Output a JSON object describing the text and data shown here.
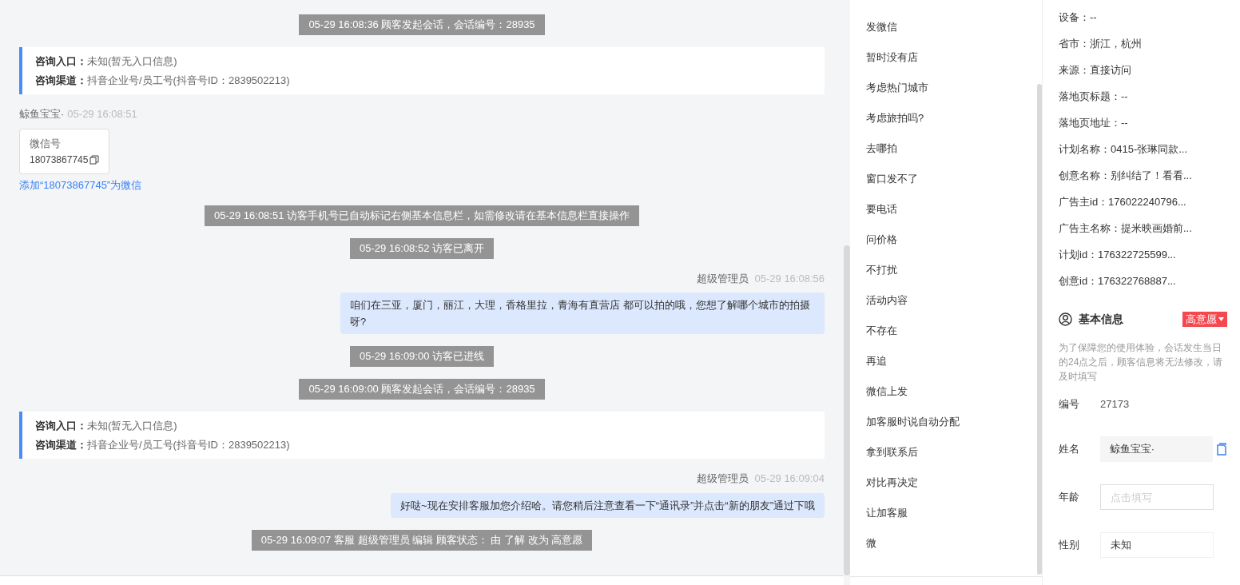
{
  "chat": [
    {
      "kind": "system",
      "text": "05-29 16:08:36 顾客发起会话，会话编号：28935"
    },
    {
      "kind": "info",
      "entry_label": "咨询入口：",
      "entry_value": "未知(暂无入口信息)",
      "channel_label": "咨询渠道：",
      "channel_value": "抖音企业号/员工号(抖音号ID：2839502213)"
    },
    {
      "kind": "customer",
      "sender": "鲸鱼宝宝·",
      "time": "05-29 16:08:51",
      "card_title": "微信号",
      "card_value": "18073867745",
      "link": "添加“18073867745”为微信"
    },
    {
      "kind": "system",
      "text": "05-29 16:08:51 访客手机号已自动标记右侧基本信息栏，如需修改请在基本信息栏直接操作"
    },
    {
      "kind": "system",
      "text": "05-29 16:08:52 访客已离开"
    },
    {
      "kind": "agent",
      "sender": "超级管理员",
      "time": "05-29 16:08:56",
      "text": "咱们在三亚，厦门，丽江，大理，香格里拉，青海有直营店 都可以拍的哦，您想了解哪个城市的拍摄呀?"
    },
    {
      "kind": "system",
      "text": "05-29 16:09:00 访客已进线"
    },
    {
      "kind": "system",
      "text": "05-29 16:09:00 顾客发起会话，会话编号：28935"
    },
    {
      "kind": "info",
      "entry_label": "咨询入口：",
      "entry_value": "未知(暂无入口信息)",
      "channel_label": "咨询渠道：",
      "channel_value": "抖音企业号/员工号(抖音号ID：2839502213)"
    },
    {
      "kind": "agent",
      "sender": "超级管理员",
      "time": "05-29 16:09:04",
      "text": "好哒~现在安排客服加您介绍哈。请您稍后注意查看一下“通讯录”并点击“新的朋友”通过下哦"
    },
    {
      "kind": "system",
      "text": "05-29 16:09:07 客服 超级管理员 编辑 顾客状态： 由 了解 改为 高意愿"
    }
  ],
  "quick_replies": [
    "发微信",
    "暂时没有店",
    "考虑热门城市",
    "考虑旅拍吗?",
    "去哪拍",
    "窗口发不了",
    "要电话",
    "问价格",
    "不打扰",
    "活动内容",
    "不存在",
    "再追",
    "微信上发",
    "加客服时说自动分配",
    "拿到联系后",
    "对比再决定",
    "让加客服",
    "微"
  ],
  "visitor_details": [
    "设备：--",
    "省市：浙江，杭州",
    "来源：直接访问",
    "落地页标题：--",
    "落地页地址：--",
    "计划名称：0415-张琳同款...",
    "创意名称：别纠结了！看看...",
    "广告主id：176022240796...",
    "广告主名称：提米映画婚前...",
    "计划id：176322725599...",
    "创意id：176322768887..."
  ],
  "basic_info": {
    "title": "基本信息",
    "intent_tag": "高意愿",
    "notice": "为了保障您的使用体验，会话发生当日的24点之后，顾客信息将无法修改，请及时填写",
    "fields": [
      {
        "kind": "text",
        "label": "编号",
        "value": "27173"
      },
      {
        "kind": "readonly",
        "label": "姓名",
        "value": "鲸鱼宝宝·"
      },
      {
        "kind": "input",
        "label": "年龄",
        "placeholder": "点击填写"
      },
      {
        "kind": "select",
        "label": "性别",
        "value": "未知"
      }
    ]
  }
}
